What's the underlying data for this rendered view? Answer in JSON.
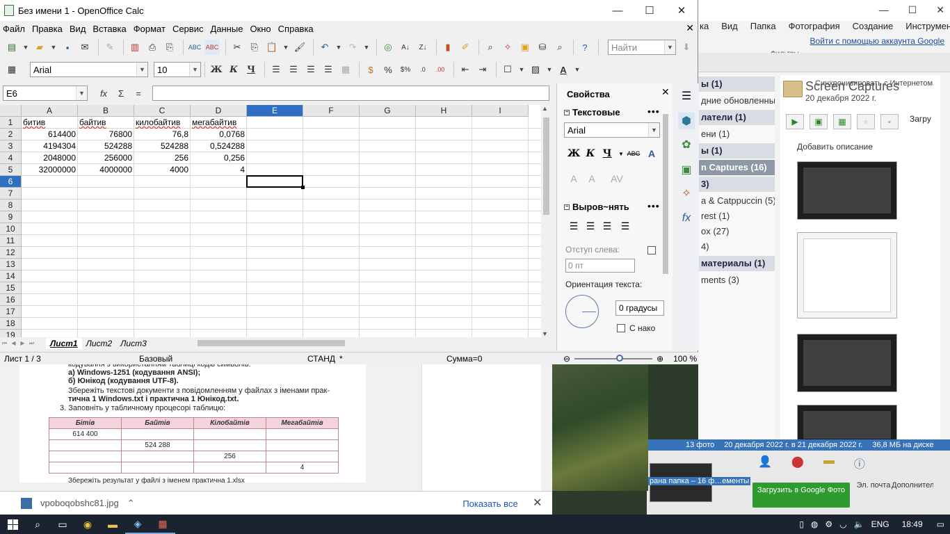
{
  "calc": {
    "title": "Без имени 1 - OpenOffice Calc",
    "menu": [
      "Файл",
      "Правка",
      "Вид",
      "Вставка",
      "Формат",
      "Сервис",
      "Данные",
      "Окно",
      "Справка"
    ],
    "find_placeholder": "Найти",
    "font_name": "Arial",
    "font_size": "10",
    "name_box": "E6",
    "formula": "",
    "columns": [
      "A",
      "B",
      "C",
      "D",
      "E",
      "F",
      "G",
      "H",
      "I"
    ],
    "selected_column": "E",
    "rows": [
      "1",
      "2",
      "3",
      "4",
      "5",
      "6",
      "7",
      "8",
      "9",
      "10",
      "11",
      "12",
      "13",
      "14",
      "15",
      "16",
      "17",
      "18",
      "19"
    ],
    "selected_row": "6",
    "cells": {
      "row1": [
        "битив",
        "байтив",
        "килобайтив",
        "мегабайтив"
      ],
      "row2": [
        "614400",
        "76800",
        "76,8",
        "0,0768"
      ],
      "row3": [
        "4194304",
        "524288",
        "524288",
        "0,524288"
      ],
      "row4": [
        "2048000",
        "256000",
        "256",
        "0,256"
      ],
      "row5": [
        "32000000",
        "4000000",
        "4000",
        "4"
      ]
    },
    "sheet_tabs": [
      "Лист1",
      "Лист2",
      "Лист3"
    ],
    "active_sheet": "Лист1",
    "status": {
      "sheet": "Лист 1 / 3",
      "style": "Базовый",
      "mode": "СТАНД",
      "modified": "*",
      "sum": "Сумма=0",
      "zoom": "100 %",
      "zoom_minus": "⊖",
      "zoom_plus": "⊕"
    },
    "sidebar": {
      "title": "Свойства",
      "text_panel": "Текстовые",
      "font": "Arial",
      "align_panel": "Выров~нять",
      "indent_label": "Отступ слева:",
      "indent_value": "0 пт",
      "orientation_label": "Ориентация текста:",
      "degrees": "0 градусы",
      "wrap_label": "С нако"
    },
    "toolbar_icons": [
      "new-icon",
      "open-icon",
      "save-icon",
      "email-icon",
      "edit-icon",
      "pdf-icon",
      "print-icon",
      "preview-icon",
      "spellcheck-icon",
      "autospell-icon",
      "cut-icon",
      "copy-icon",
      "paste-icon",
      "format-paintbrush-icon",
      "undo-icon",
      "redo-icon",
      "navigator-icon",
      "sort-ascending-icon",
      "sort-descending-icon",
      "chart-icon",
      "draw-icon",
      "find-replace-icon",
      "navigator-compass-icon",
      "gallery-icon",
      "datasources-icon",
      "zoom-icon",
      "help-icon"
    ]
  },
  "picasa": {
    "menu": [
      "ка",
      "Вид",
      "Папка",
      "Фотография",
      "Создание",
      "Инструменты"
    ],
    "signin": "Войти с помощью аккаунта Google",
    "filters_label": "Фильтры",
    "sync": "Синхронизировать с Интернетом",
    "album_title": "Screen Captures",
    "album_date": "20 декабря 2022 г.",
    "add_description": "Добавить описание",
    "upload_small": "Загру",
    "folders": [
      {
        "label": "ы (1)",
        "type": "hdr"
      },
      {
        "label": "дние обновленные...",
        "type": "item"
      },
      {
        "label": "латели (1)",
        "type": "hdr"
      },
      {
        "label": "ени (1)",
        "type": "item"
      },
      {
        "label": "ы (1)",
        "type": "hdr"
      },
      {
        "label": "n Captures (16)",
        "type": "sel"
      },
      {
        "label": "3)",
        "type": "hdr"
      },
      {
        "label": "a & Catppuccin (5)",
        "type": "item"
      },
      {
        "label": "rest (1)",
        "type": "item"
      },
      {
        "label": "ox (27)",
        "type": "item"
      },
      {
        "label": "4)",
        "type": "item"
      },
      {
        "label": "материалы (1)",
        "type": "hdr"
      },
      {
        "label": "ments (3)",
        "type": "item"
      }
    ],
    "status": [
      "13 фото",
      "20 декабря 2022 г. в 21 декабря 2022 г.",
      "36,8 МБ на диске"
    ],
    "tray_label": "рана папка – 16 ф",
    "tray_label2": "ементы",
    "upload_button": "Загрузить в Google Фото",
    "email": "Эл. почта",
    "more": "Дополнительно..."
  },
  "document": {
    "lines": [
      "кодування з використанням таблиці кодів символів:",
      "а)  Windows-1251 (кодування ANSI);",
      "б)  Юнікод (кодування UTF-8).",
      "Збережіть текстові документи з повідомленням у файлах з іменами прак-",
      "тична 1 Windows.txt і практична 1 Юнікод.txt.",
      "3. Заповніть у табличному процесорі таблицю:",
      "Збережіть результат у файлі з іменем практична 1.xlsx"
    ],
    "table_headers": [
      "Бітів",
      "Байтів",
      "Кілобайтів",
      "Мегабайтів"
    ],
    "table_rows": [
      [
        "614 400",
        "",
        "",
        ""
      ],
      [
        "",
        "524 288",
        "",
        ""
      ],
      [
        "",
        "",
        "256",
        ""
      ],
      [
        "",
        "",
        "",
        "4"
      ]
    ]
  },
  "downloads": {
    "file": "vpoboqobshc81.jpg",
    "show_all": "Показать все"
  },
  "taskbar": {
    "lang": "ENG",
    "time": "18:49"
  }
}
